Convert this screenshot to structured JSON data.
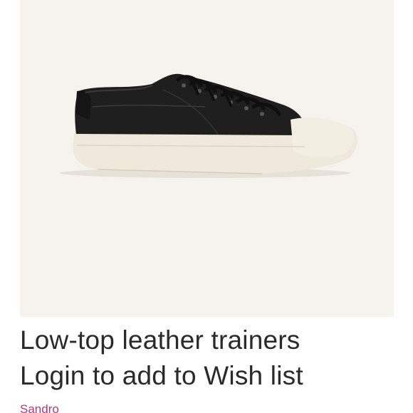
{
  "product": {
    "title": "Low-top leather trainers",
    "wishlist_prompt": "Login to add to Wish list",
    "brand": "Sandro",
    "image_icon": "sneaker-image"
  },
  "colors": {
    "image_background": "#f6f3ee",
    "text": "#2a2a2a",
    "brand": "#b03a7e",
    "upper_leather": "#1e1e1e",
    "sole": "#efe9db"
  }
}
